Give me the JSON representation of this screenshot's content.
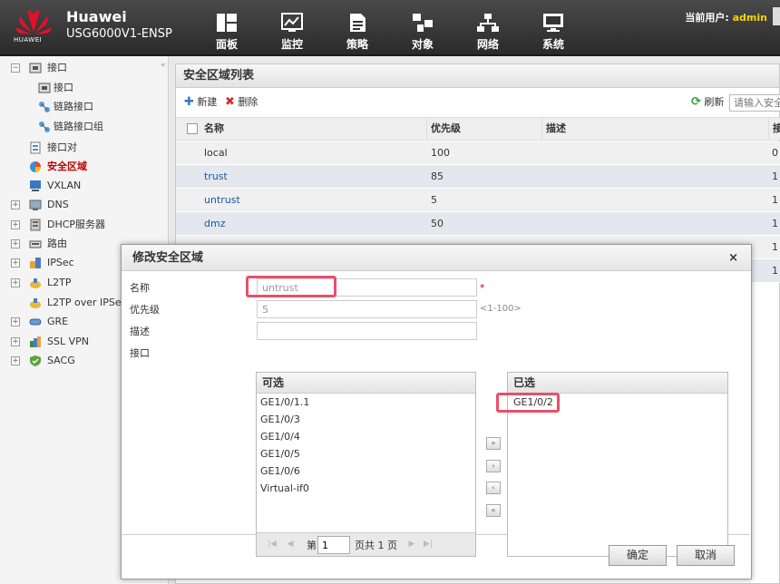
{
  "header": {
    "brand": "Huawei",
    "model": "USG6000V1-ENSP",
    "logo_text": "HUAWEI",
    "user_label": "当前用户:",
    "user_name": "admin",
    "nav": [
      {
        "label": "面板",
        "icon": "dashboard-icon"
      },
      {
        "label": "监控",
        "icon": "monitor-chart-icon"
      },
      {
        "label": "策略",
        "icon": "policy-doc-icon"
      },
      {
        "label": "对象",
        "icon": "object-icon"
      },
      {
        "label": "网络",
        "icon": "network-icon"
      },
      {
        "label": "系统",
        "icon": "system-icon"
      }
    ]
  },
  "sidebar": {
    "items": [
      {
        "label": "接口",
        "expander": "−"
      },
      {
        "label": "接口"
      },
      {
        "label": "链路接口"
      },
      {
        "label": "链路接口组"
      },
      {
        "label": "接口对"
      },
      {
        "label": "安全区域"
      },
      {
        "label": "VXLAN"
      },
      {
        "label": "DNS",
        "expander": "+"
      },
      {
        "label": "DHCP服务器",
        "expander": "+"
      },
      {
        "label": "路由",
        "expander": "+"
      },
      {
        "label": "IPSec",
        "expander": "+"
      },
      {
        "label": "L2TP",
        "expander": "+"
      },
      {
        "label": "L2TP over IPSec"
      },
      {
        "label": "GRE",
        "expander": "+"
      },
      {
        "label": "SSL VPN",
        "expander": "+"
      },
      {
        "label": "SACG",
        "expander": "+"
      }
    ],
    "collapse_glyph": "«"
  },
  "panel": {
    "title": "安全区域列表",
    "new_label": "新建",
    "delete_label": "删除",
    "refresh_label": "刷新",
    "search_placeholder": "请输入安全",
    "columns": [
      "名称",
      "优先级",
      "描述",
      "接"
    ],
    "rows": [
      {
        "name": "local",
        "priority": "100",
        "desc": "",
        "iface": "0"
      },
      {
        "name": "trust",
        "priority": "85",
        "desc": "",
        "iface": "1"
      },
      {
        "name": "untrust",
        "priority": "5",
        "desc": "",
        "iface": "1"
      },
      {
        "name": "dmz",
        "priority": "50",
        "desc": "",
        "iface": "1"
      },
      {
        "name": "",
        "priority": "",
        "desc": "",
        "iface": "1"
      },
      {
        "name": "",
        "priority": "",
        "desc": "",
        "iface": "1"
      }
    ]
  },
  "modal": {
    "title": "修改安全区域",
    "close": "×",
    "name_label": "名称",
    "name_value": "untrust",
    "required_mark": "*",
    "priority_label": "优先级",
    "priority_value": "5",
    "priority_hint": "<1-100>",
    "desc_label": "描述",
    "desc_value": "",
    "iface_label": "接口",
    "available_title": "可选",
    "available": [
      "GE1/0/1.1",
      "GE1/0/3",
      "GE1/0/4",
      "GE1/0/5",
      "GE1/0/6",
      "Virtual-if0"
    ],
    "selected_title": "已选",
    "selected": [
      "GE1/0/2"
    ],
    "pager": {
      "prefix": "第",
      "page": "1",
      "suffix": "页共 1 页"
    },
    "arrows": [
      "»",
      "›",
      "‹",
      "«"
    ],
    "ok_label": "确定",
    "cancel_label": "取消"
  },
  "colors": {
    "active": "#c00000",
    "link": "#1a56a8",
    "highlight": "#e8506a",
    "user": "#f5d300"
  }
}
